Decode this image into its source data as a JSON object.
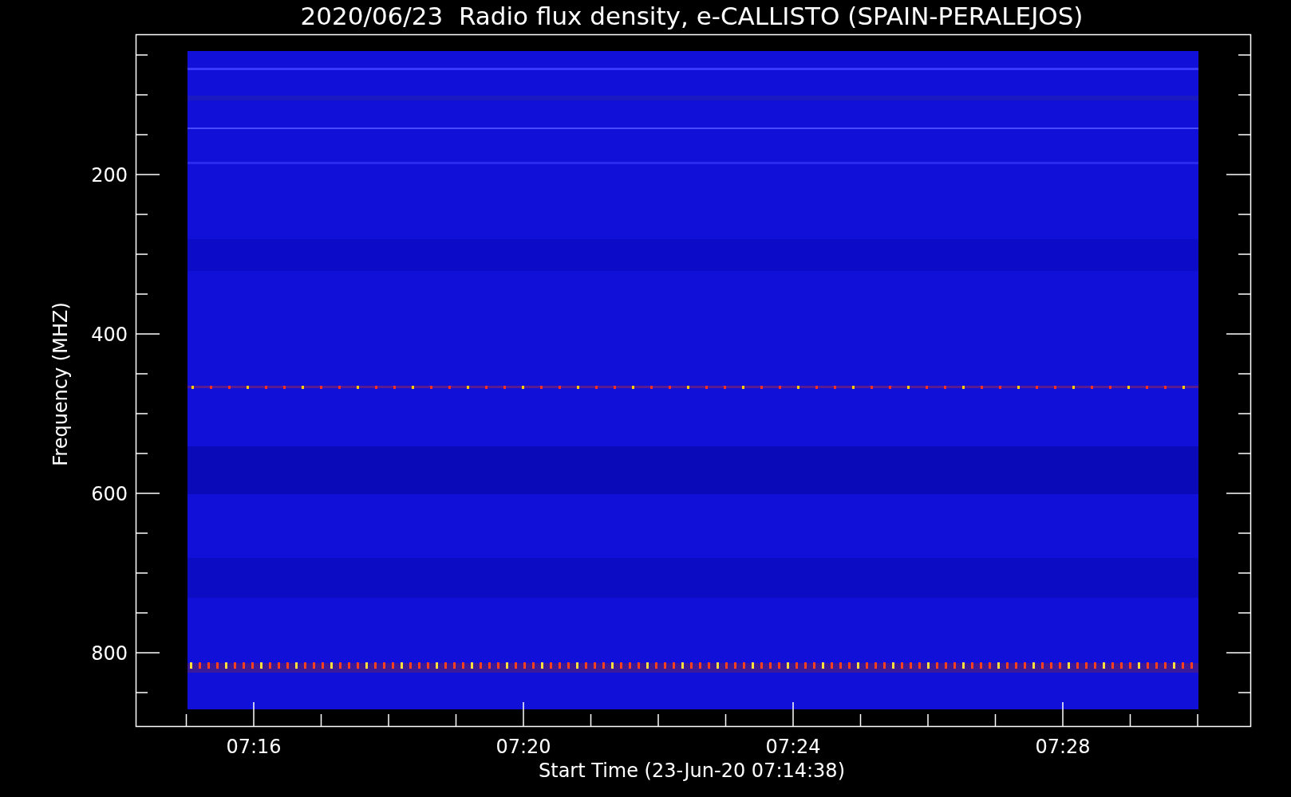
{
  "title": "2020/06/23  Radio flux density, e-CALLISTO (SPAIN-PERALEJOS)",
  "y_axis": {
    "label": "Frequency (MHZ)",
    "tick_labels": [
      "200",
      "400",
      "600",
      "800"
    ]
  },
  "x_axis": {
    "label": "Start Time (23-Jun-20 07:14:38)",
    "tick_labels": [
      "07:16",
      "07:20",
      "07:24",
      "07:28"
    ]
  }
}
